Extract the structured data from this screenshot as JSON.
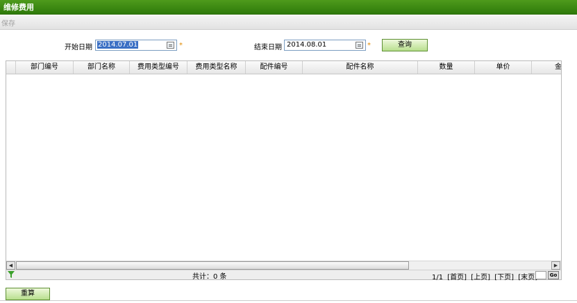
{
  "window": {
    "title": "维修费用"
  },
  "toolbar": {
    "save_label": "保存"
  },
  "filter": {
    "start_label": "开始日期",
    "start_value": "2014.07.01",
    "end_label": "结束日期",
    "end_value": "2014.08.01",
    "required_mark": "*",
    "query_label": "查询"
  },
  "grid": {
    "columns": [
      "部门编号",
      "部门名称",
      "费用类型编号",
      "费用类型名称",
      "配件编号",
      "配件名称",
      "数量",
      "单价",
      "金"
    ],
    "rows": [],
    "total_text": "共计：0 条",
    "pager": {
      "page_info": "1/1",
      "first": "[首页]",
      "prev": "[上页]",
      "next": "[下页]",
      "last": "[末页]",
      "go": "Go"
    }
  },
  "footer": {
    "recalc_label": "重算"
  },
  "colors": {
    "title_bar": "#3a8a12",
    "button_green": "#b8df8e",
    "selection": "#3a6fc4",
    "required": "#e08a00"
  }
}
